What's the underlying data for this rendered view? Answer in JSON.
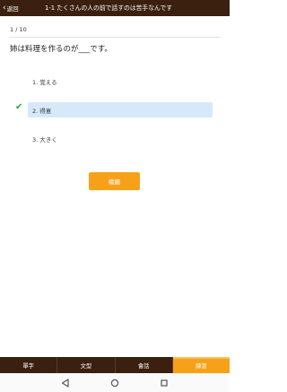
{
  "header": {
    "back_label": "返回",
    "title": "1-1 たくさんの人の前で話すのは苦手なんです"
  },
  "quiz": {
    "counter": "1 / 10",
    "question": "姉は料理を作るのが___です。",
    "options": [
      {
        "label": "1. 覚える"
      },
      {
        "label": "2. 得意"
      },
      {
        "label": "3. 大きく"
      }
    ],
    "selected_index": 1,
    "next_label": "繼續"
  },
  "tabs": [
    {
      "label": "單字"
    },
    {
      "label": "文型"
    },
    {
      "label": "會話"
    },
    {
      "label": "練習"
    }
  ],
  "active_tab": 3,
  "colors": {
    "brand_dark": "#3b200f",
    "accent": "#f7a11a",
    "selected_bg": "#d6e9fb",
    "check": "#2ba24c"
  }
}
